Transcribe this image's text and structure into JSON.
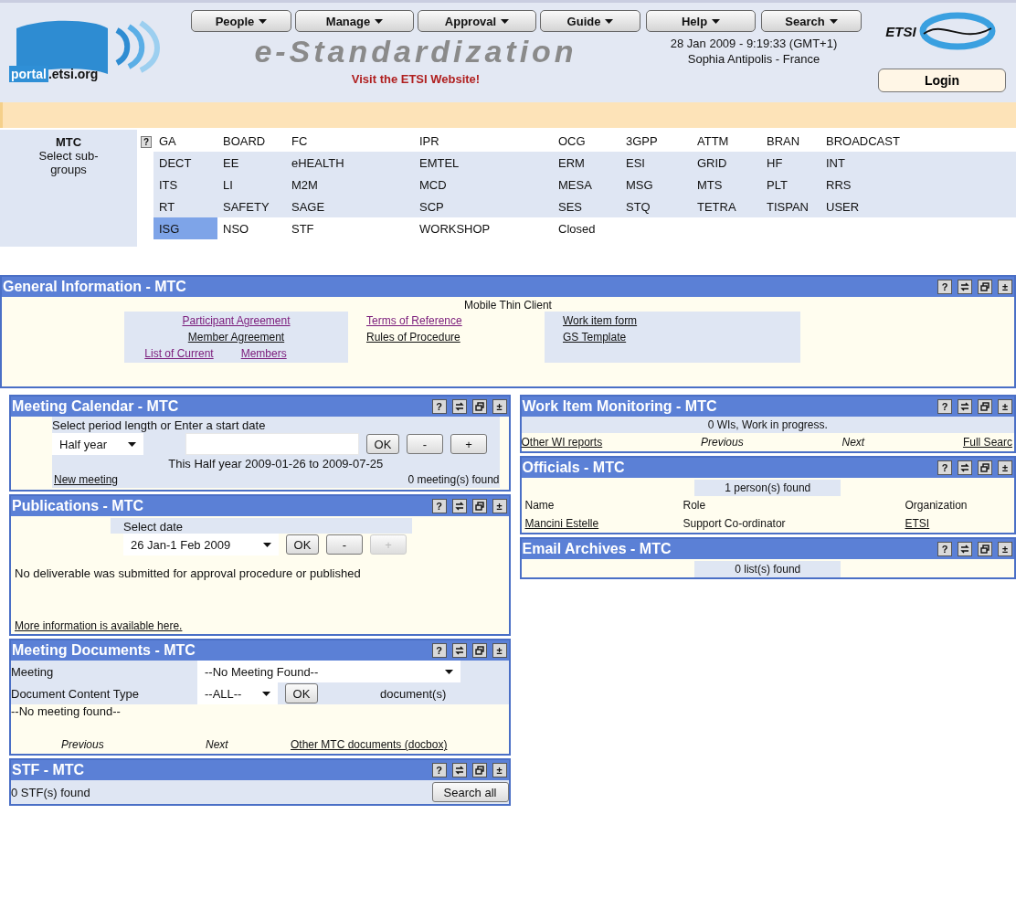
{
  "header": {
    "logo_word": "portal",
    "logo_domain": ".etsi.org",
    "nav": [
      {
        "label": "People"
      },
      {
        "label": "Manage"
      },
      {
        "label": "Approval"
      },
      {
        "label": "Guide"
      }
    ],
    "nav_right": [
      {
        "label": "Help"
      },
      {
        "label": "Search"
      }
    ],
    "title": "e-Standardization",
    "site_link": "Visit the ETSI Website!",
    "datetime": "28 Jan 2009 - 9:19:33 (GMT+1)",
    "location": "Sophia Antipolis - France",
    "brand": "ETSI",
    "login": "Login"
  },
  "subgroups": {
    "group": "MTC",
    "label": "Select sub-groups",
    "help": "?",
    "rows": [
      {
        "cells": [
          {
            "label": "GA",
            "selected": false
          },
          {
            "label": "BOARD",
            "selected": false
          },
          {
            "label": "FC",
            "selected": false
          },
          {
            "label": "IPR",
            "selected": false
          },
          {
            "label": "OCG",
            "selected": false
          },
          {
            "label": "3GPP",
            "selected": false
          },
          {
            "label": "ATTM",
            "selected": false
          },
          {
            "label": "BRAN",
            "selected": false
          },
          {
            "label": "BROADCAST",
            "selected": false
          }
        ]
      },
      {
        "cells": [
          {
            "label": "DECT",
            "selected": false
          },
          {
            "label": "EE",
            "selected": false
          },
          {
            "label": "eHEALTH",
            "selected": false
          },
          {
            "label": "EMTEL",
            "selected": false
          },
          {
            "label": "ERM",
            "selected": false
          },
          {
            "label": "ESI",
            "selected": false
          },
          {
            "label": "GRID",
            "selected": false
          },
          {
            "label": "HF",
            "selected": false
          },
          {
            "label": "INT",
            "selected": false
          }
        ]
      },
      {
        "cells": [
          {
            "label": "ITS",
            "selected": false
          },
          {
            "label": "LI",
            "selected": false
          },
          {
            "label": "M2M",
            "selected": false
          },
          {
            "label": "MCD",
            "selected": false
          },
          {
            "label": "MESA",
            "selected": false
          },
          {
            "label": "MSG",
            "selected": false
          },
          {
            "label": "MTS",
            "selected": false
          },
          {
            "label": "PLT",
            "selected": false
          },
          {
            "label": "RRS",
            "selected": false
          }
        ]
      },
      {
        "cells": [
          {
            "label": "RT",
            "selected": false
          },
          {
            "label": "SAFETY",
            "selected": false
          },
          {
            "label": "SAGE",
            "selected": false
          },
          {
            "label": "SCP",
            "selected": false
          },
          {
            "label": "SES",
            "selected": false
          },
          {
            "label": "STQ",
            "selected": false
          },
          {
            "label": "TETRA",
            "selected": false
          },
          {
            "label": "TISPAN",
            "selected": false
          },
          {
            "label": "USER",
            "selected": false
          }
        ]
      },
      {
        "cells": [
          {
            "label": "ISG",
            "selected": true
          },
          {
            "label": "NSO",
            "selected": false
          },
          {
            "label": "STF",
            "selected": false
          },
          {
            "label": "WORKSHOP",
            "selected": false
          },
          {
            "label": "Closed",
            "selected": false
          }
        ]
      }
    ]
  },
  "general": {
    "title": "General Information - MTC",
    "help": "?",
    "toggle": "±",
    "subtitle": "Mobile Thin Client",
    "left_links": [
      {
        "label": "Participant Agreement",
        "visited": true
      },
      {
        "label": "Member Agreement",
        "visited": false
      }
    ],
    "current_links": [
      {
        "label": "List of Current",
        "visited": true
      },
      {
        "label": "Members",
        "visited": true
      }
    ],
    "middle_links": [
      {
        "label": "Terms of Reference",
        "visited": true
      },
      {
        "label": "Rules of Procedure",
        "visited": false
      }
    ],
    "right_links": [
      {
        "label": "Work item form",
        "visited": false
      },
      {
        "label": "GS Template",
        "visited": false
      }
    ]
  },
  "meeting_calendar": {
    "title": "Meeting Calendar - MTC",
    "help": "?",
    "toggle": "±",
    "prompt": "Select period length or Enter a start date",
    "period": "Half year",
    "ok": "OK",
    "prev": "-",
    "next": "+",
    "range": "This Half year 2009-01-26 to 2009-07-25",
    "new_link": "New meeting",
    "count": "0 meeting(s) found"
  },
  "publications": {
    "title": "Publications - MTC",
    "help": "?",
    "toggle": "±",
    "label": "Select date",
    "date": "26 Jan-1 Feb 2009",
    "ok": "OK",
    "prev": "-",
    "next": {
      "label": "+",
      "disabled": true
    },
    "message": "No deliverable was submitted for approval procedure or published",
    "more_link": "More information is available here."
  },
  "meeting_documents": {
    "title": "Meeting Documents - MTC",
    "help": "?",
    "toggle": "±",
    "meeting_label": "Meeting",
    "meeting_value": "--No Meeting Found--",
    "type_label": "Document Content Type",
    "type_value": "--ALL--",
    "ok": "OK",
    "doc_count": "document(s)",
    "empty": "--No meeting found--",
    "previous": "Previous",
    "next": "Next",
    "other_link": "Other MTC documents (docbox)"
  },
  "stf": {
    "title": "STF - MTC",
    "help": "?",
    "toggle": "±",
    "count": "0 STF(s) found",
    "search": "Search all"
  },
  "work_items": {
    "title": "Work Item Monitoring - MTC",
    "help": "?",
    "toggle": "±",
    "status": "0 WIs, Work in progress.",
    "reports_link": "Other WI reports",
    "previous": "Previous",
    "next": "Next",
    "search_link": "Full Searc"
  },
  "officials": {
    "title": "Officials - MTC",
    "help": "?",
    "toggle": "±",
    "count": "1 person(s) found",
    "columns": [
      "Name",
      "Role",
      "Organization"
    ],
    "rows": [
      {
        "name": "Mancini Estelle",
        "role": "Support Co-ordinator",
        "organization": "ETSI"
      }
    ]
  },
  "email_archives": {
    "title": "Email Archives - MTC",
    "help": "?",
    "toggle": "±",
    "count": "0 list(s) found"
  }
}
